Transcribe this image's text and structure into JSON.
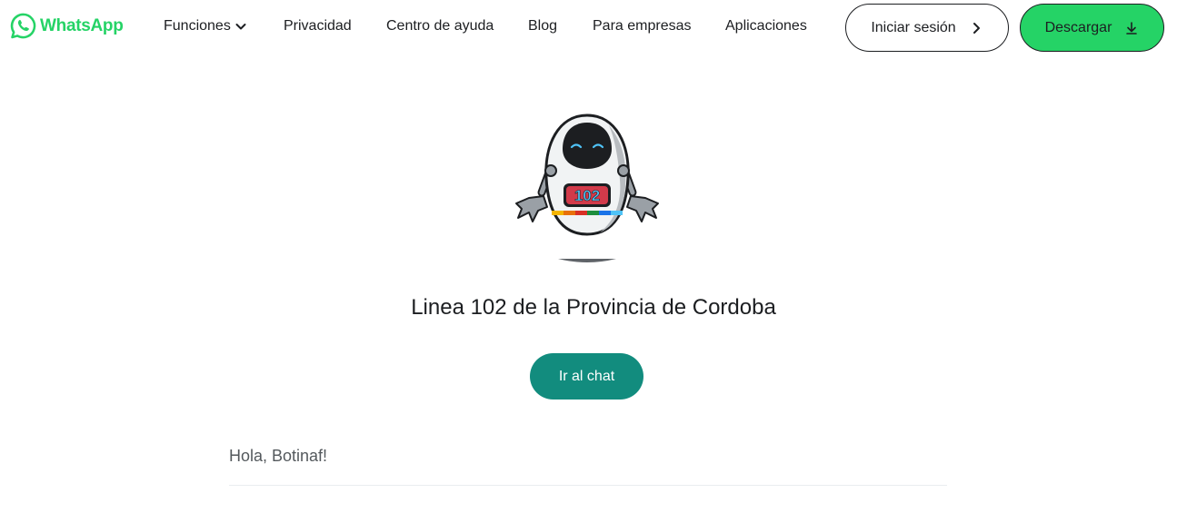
{
  "brand": {
    "name": "WhatsApp",
    "color": "#25d366",
    "icon": "whatsapp-logo-icon"
  },
  "nav": {
    "items": [
      {
        "label": "Funciones",
        "icon": "chevron-down-icon"
      },
      {
        "label": "Privacidad"
      },
      {
        "label": "Centro de ayuda"
      },
      {
        "label": "Blog"
      },
      {
        "label": "Para empresas"
      },
      {
        "label": "Aplicaciones"
      }
    ]
  },
  "actions": {
    "login_label": "Iniciar sesión",
    "login_icon": "chevron-right-icon",
    "download_label": "Descargar",
    "download_icon": "download-icon"
  },
  "profile": {
    "title": "Linea 102 de la Provincia de Cordoba",
    "avatar_badge": "102",
    "chat_button_label": "Ir al chat",
    "chat_button_color": "#128c7e",
    "message": "Hola, Botinaf!"
  }
}
